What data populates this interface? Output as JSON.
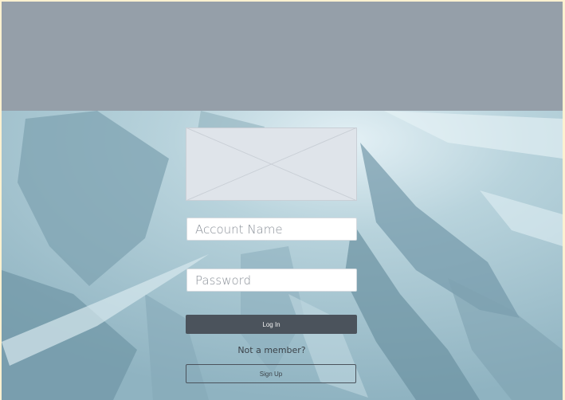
{
  "colors": {
    "header": "#959fa9",
    "background_tint": "#a9c6d0",
    "login_button": "#4b535c",
    "page_border": "#fdf1d0"
  },
  "background_image": {
    "icon": "ice-crystal-photo"
  },
  "logo_placeholder": {
    "icon": "image-placeholder-x"
  },
  "form": {
    "account_placeholder": "Account Name",
    "account_value": "",
    "password_placeholder": "Password",
    "password_value": "",
    "login_label": "Log In",
    "not_member_text": "Not a member?",
    "signup_label": "Sign Up"
  }
}
